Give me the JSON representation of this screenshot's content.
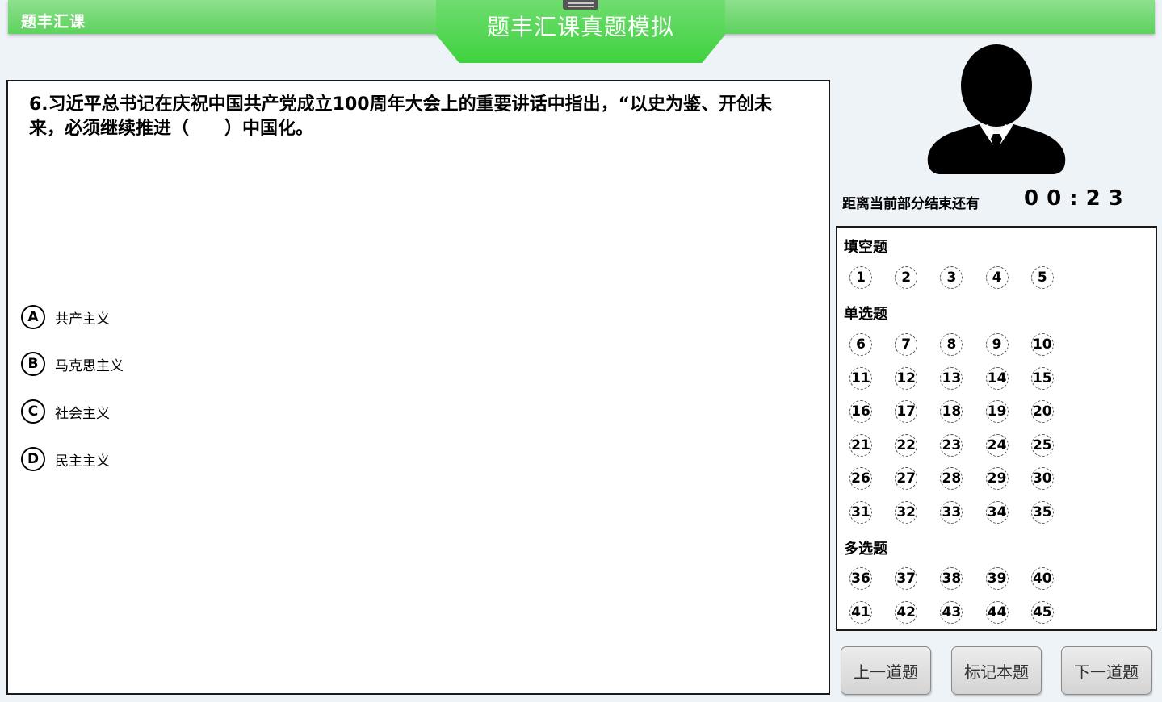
{
  "app": {
    "brand": "题丰汇课",
    "title": "题丰汇课真题模拟"
  },
  "question": {
    "text": "6.习近平总书记在庆祝中国共产党成立100周年大会上的重要讲话中指出，“以史为鉴、开创未来，必须继续推进（　　）中国化。",
    "options": [
      {
        "letter": "A",
        "label": "共产主义"
      },
      {
        "letter": "B",
        "label": "马克思主义"
      },
      {
        "letter": "C",
        "label": "社会主义"
      },
      {
        "letter": "D",
        "label": "民主主义"
      }
    ]
  },
  "timer": {
    "label": "距离当前部分结束还有",
    "value": "00:23"
  },
  "navigator": {
    "sections": [
      {
        "title": "填空题",
        "numbers": [
          "1",
          "2",
          "3",
          "4",
          "5"
        ]
      },
      {
        "title": "单选题",
        "numbers": [
          "6",
          "7",
          "8",
          "9",
          "10",
          "11",
          "12",
          "13",
          "14",
          "15",
          "16",
          "17",
          "18",
          "19",
          "20",
          "21",
          "22",
          "23",
          "24",
          "25",
          "26",
          "27",
          "28",
          "29",
          "30",
          "31",
          "32",
          "33",
          "34",
          "35"
        ]
      },
      {
        "title": "多选题",
        "numbers": [
          "36",
          "37",
          "38",
          "39",
          "40",
          "41",
          "42",
          "43",
          "44",
          "45"
        ]
      }
    ]
  },
  "buttons": {
    "prev": "上一道题",
    "mark": "标记本题",
    "next": "下一道题"
  },
  "colors": {
    "header_green": "#5cd35c",
    "tab_green": "#3fd23f"
  }
}
